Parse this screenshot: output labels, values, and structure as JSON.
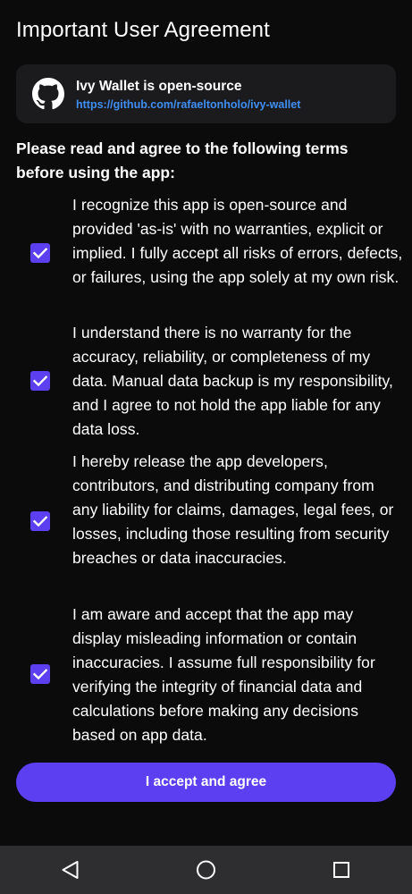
{
  "header": {
    "title": "Important User Agreement"
  },
  "repo": {
    "icon": "github-icon",
    "name": "Ivy Wallet is open-source",
    "url": "https://github.com/rafaeltonholo/ivy-wallet"
  },
  "terms": {
    "heading": "Please read and agree to the following terms before using the app:",
    "items": [
      {
        "checked": true,
        "text": "I recognize this app is open-source and provided 'as-is' with no warranties, explicit or implied. I fully accept all risks of errors, defects, or failures, using the app solely at my own risk."
      },
      {
        "checked": true,
        "text": "I understand there is no warranty for the accuracy, reliability, or completeness of my data. Manual data backup is my responsibility, and I agree to not hold the app liable for any data loss."
      },
      {
        "checked": true,
        "text": "I hereby release the app developers, contributors, and distributing company from any liability for claims, damages, legal fees, or losses, including those resulting from security breaches or data inaccuracies."
      },
      {
        "checked": true,
        "text": "I am aware and accept that the app may display misleading information or contain inaccuracies. I assume full responsibility for verifying the integrity of financial data and calculations before making any decisions based on app data."
      }
    ]
  },
  "actions": {
    "accept_label": "I accept and agree"
  },
  "navigation": {
    "back_icon": "back-triangle-icon",
    "home_icon": "home-circle-icon",
    "recents_icon": "recents-square-icon"
  },
  "colors": {
    "background": "#0b0b0c",
    "card": "#1b1b1e",
    "accent": "#5b3ff0",
    "link": "#3f8ef1",
    "nav_bar": "#2e2e31"
  }
}
